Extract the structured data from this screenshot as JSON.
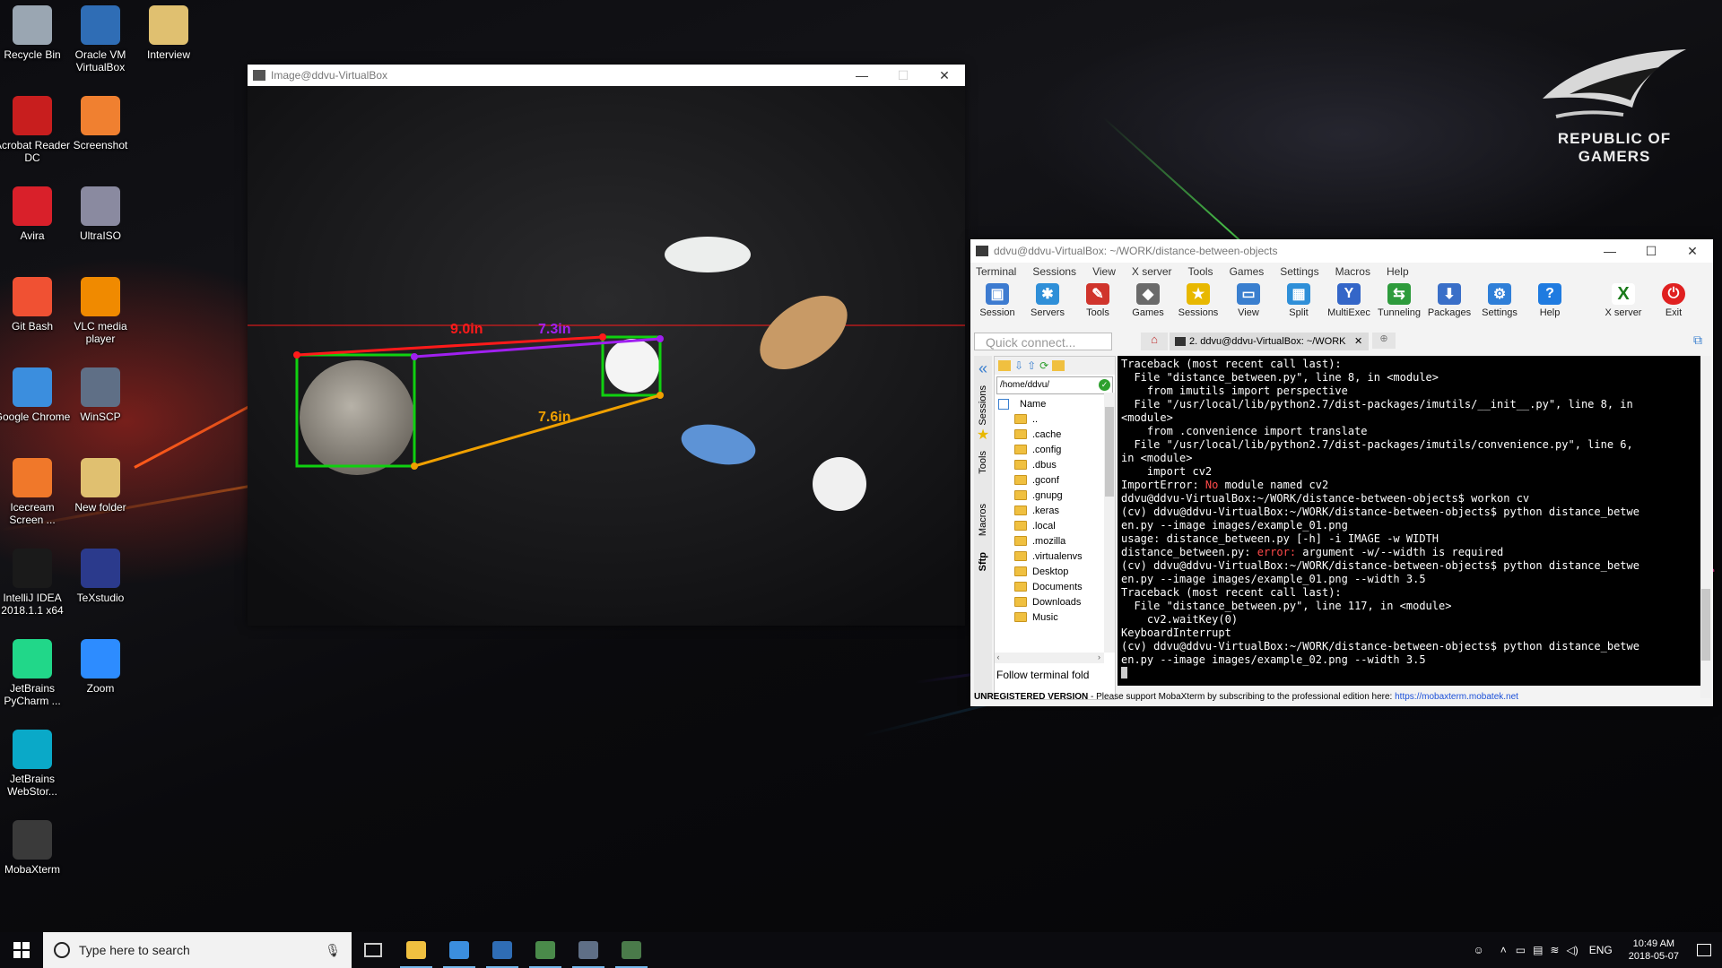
{
  "desktop": {
    "icons": [
      {
        "label": "Recycle Bin",
        "icon": "recycle-bin-icon",
        "color": "#9aa6b2"
      },
      {
        "label": "Oracle VM VirtualBox",
        "icon": "virtualbox-icon",
        "color": "#2f6db5"
      },
      {
        "label": "Interview",
        "icon": "folder-pdf-icon",
        "color": "#e0c070"
      },
      {
        "label": "Acrobat Reader DC",
        "icon": "acrobat-icon",
        "color": "#c81e1e"
      },
      {
        "label": "Screenshot",
        "icon": "camera-icon",
        "color": "#f08030"
      },
      {
        "label": "Avira",
        "icon": "avira-icon",
        "color": "#d9202a"
      },
      {
        "label": "UltraISO",
        "icon": "disc-icon",
        "color": "#8a8aa0"
      },
      {
        "label": "Git Bash",
        "icon": "git-icon",
        "color": "#f05133"
      },
      {
        "label": "VLC media player",
        "icon": "vlc-icon",
        "color": "#f08a00"
      },
      {
        "label": "Google Chrome",
        "icon": "chrome-icon",
        "color": "#3b8ede"
      },
      {
        "label": "WinSCP",
        "icon": "winscp-icon",
        "color": "#5f6f86"
      },
      {
        "label": "Icecream Screen ...",
        "icon": "icecream-icon",
        "color": "#f0782a"
      },
      {
        "label": "New folder",
        "icon": "folder-pdf-icon",
        "color": "#e0c070"
      },
      {
        "label": "IntelliJ IDEA 2018.1.1 x64",
        "icon": "intellij-icon",
        "color": "#1a1a1a"
      },
      {
        "label": "TeXstudio",
        "icon": "texstudio-icon",
        "color": "#2b3a8c"
      },
      {
        "label": "JetBrains PyCharm ...",
        "icon": "pycharm-icon",
        "color": "#21d789"
      },
      {
        "label": "Zoom",
        "icon": "zoom-icon",
        "color": "#2d8cff"
      },
      {
        "label": "JetBrains WebStor...",
        "icon": "webstorm-icon",
        "color": "#0aa9c8"
      },
      {
        "label": "MobaXterm",
        "icon": "mobaxterm-icon",
        "color": "#3a3a3a"
      }
    ],
    "rog_text_1": "REPUBLIC OF",
    "rog_text_2": "GAMERS"
  },
  "image_window": {
    "title": "Image@ddvu-VirtualBox",
    "annotations": [
      "9.0in",
      "7.3in",
      "7.6in"
    ],
    "annotation_colors": {
      "red": "#ff1a1a",
      "purple": "#a020f0",
      "orange": "#f0a000",
      "green": "#10d010"
    }
  },
  "moba": {
    "title": "ddvu@ddvu-VirtualBox: ~/WORK/distance-between-objects",
    "menu": [
      "Terminal",
      "Sessions",
      "View",
      "X server",
      "Tools",
      "Games",
      "Settings",
      "Macros",
      "Help"
    ],
    "tools": [
      {
        "label": "Session",
        "color": "#3d7bd0",
        "glyph": "▣"
      },
      {
        "label": "Servers",
        "color": "#2f8fd8",
        "glyph": "✱"
      },
      {
        "label": "Tools",
        "color": "#d0342c",
        "glyph": "✎"
      },
      {
        "label": "Games",
        "color": "#6a6a6a",
        "glyph": "◆"
      },
      {
        "label": "Sessions",
        "color": "#e8b800",
        "glyph": "★"
      },
      {
        "label": "View",
        "color": "#3a7fcf",
        "glyph": "▭"
      },
      {
        "label": "Split",
        "color": "#2f8fd8",
        "glyph": "▦"
      },
      {
        "label": "MultiExec",
        "color": "#3466c8",
        "glyph": "Y"
      },
      {
        "label": "Tunneling",
        "color": "#2e9b3c",
        "glyph": "⇆"
      },
      {
        "label": "Packages",
        "color": "#3a6fc8",
        "glyph": "⬇"
      },
      {
        "label": "Settings",
        "color": "#2f7fd8",
        "glyph": "⚙"
      },
      {
        "label": "Help",
        "color": "#1f7be0",
        "glyph": "?"
      }
    ],
    "xserver_label": "X server",
    "exit_label": "Exit",
    "quick_connect_placeholder": "Quick connect...",
    "tab_label": "2. ddvu@ddvu-VirtualBox: ~/WORK",
    "path_value": "/home/ddvu/",
    "side_tabs": [
      "Sessions",
      "Tools",
      "Macros",
      "Sftp"
    ],
    "tree_header": "Name",
    "tree_items": [
      "..",
      ".cache",
      ".config",
      ".dbus",
      ".gconf",
      ".gnupg",
      ".keras",
      ".local",
      ".mozilla",
      ".virtualenvs",
      "Desktop",
      "Documents",
      "Downloads",
      "Music"
    ],
    "follow_label": "Follow terminal fold",
    "status_unregistered": "UNREGISTERED VERSION",
    "status_text": " -  Please support MobaXterm by subscribing to the professional edition here: ",
    "status_link": "https://mobaxterm.mobatek.net",
    "terminal_lines": [
      "Traceback (most recent call last):",
      "  File \"distance_between.py\", line 8, in <module>",
      "    from imutils import perspective",
      "  File \"/usr/local/lib/python2.7/dist-packages/imutils/__init__.py\", line 8, in",
      "<module>",
      "    from .convenience import translate",
      "  File \"/usr/local/lib/python2.7/dist-packages/imutils/convenience.py\", line 6,",
      "in <module>",
      "    import cv2",
      "ImportError: No module named cv2",
      "ddvu@ddvu-VirtualBox:~/WORK/distance-between-objects$ workon cv",
      "(cv) ddvu@ddvu-VirtualBox:~/WORK/distance-between-objects$ python distance_betwe",
      "en.py --image images/example_01.png",
      "usage: distance_between.py [-h] -i IMAGE -w WIDTH",
      "distance_between.py: error: argument -w/--width is required",
      "(cv) ddvu@ddvu-VirtualBox:~/WORK/distance-between-objects$ python distance_betwe",
      "en.py --image images/example_01.png --width 3.5",
      "Traceback (most recent call last):",
      "  File \"distance_between.py\", line 117, in <module>",
      "    cv2.waitKey(0)",
      "KeyboardInterrupt",
      "(cv) ddvu@ddvu-VirtualBox:~/WORK/distance-between-objects$ python distance_betwe",
      "en.py --image images/example_02.png --width 3.5"
    ]
  },
  "taskbar": {
    "search_placeholder": "Type here to search",
    "lang": "ENG",
    "time": "10:49 AM",
    "date": "2018-05-07",
    "apps": [
      {
        "name": "file-explorer-icon",
        "color": "#f0c040"
      },
      {
        "name": "chrome-icon",
        "color": "#3b8ede"
      },
      {
        "name": "virtualbox-icon",
        "color": "#2f6db5"
      },
      {
        "name": "image-viewer-icon",
        "color": "#4a8a4a"
      },
      {
        "name": "winscp-icon",
        "color": "#5f6f86"
      },
      {
        "name": "mobaxterm-icon",
        "color": "#4a7a4a"
      }
    ]
  }
}
